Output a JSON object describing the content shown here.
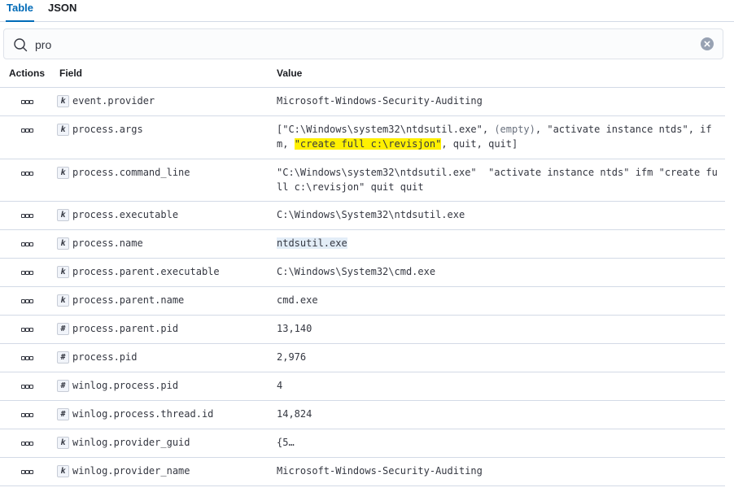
{
  "tabs": [
    "Table",
    "JSON"
  ],
  "search": {
    "value": "pro",
    "placeholder": ""
  },
  "columns": {
    "actions": "Actions",
    "field": "Field",
    "value": "Value"
  },
  "rows": [
    {
      "type": "k",
      "field": "event.provider",
      "value": "Microsoft-Windows-Security-Auditing"
    },
    {
      "type": "k",
      "field": "process.args",
      "value_parts": [
        "[\"C:\\Windows\\system32\\ntdsutil.exe\", ",
        "(empty)",
        ", \"activate instance ntds\", ifm, ",
        "\"create full c:\\revisjon\"",
        ", quit, quit]"
      ]
    },
    {
      "type": "k",
      "field": "process.command_line",
      "value": "\"C:\\Windows\\system32\\ntdsutil.exe\"  \"activate instance ntds\" ifm \"create full c:\\revisjon\" quit quit"
    },
    {
      "type": "k",
      "field": "process.executable",
      "value": "C:\\Windows\\System32\\ntdsutil.exe"
    },
    {
      "type": "k",
      "field": "process.name",
      "value": "ntdsutil.exe"
    },
    {
      "type": "k",
      "field": "process.parent.executable",
      "value": "C:\\Windows\\System32\\cmd.exe"
    },
    {
      "type": "k",
      "field": "process.parent.name",
      "value": "cmd.exe"
    },
    {
      "type": "#",
      "field": "process.parent.pid",
      "value": "13,140"
    },
    {
      "type": "#",
      "field": "process.pid",
      "value": "2,976"
    },
    {
      "type": "#",
      "field": "winlog.process.pid",
      "value": "4"
    },
    {
      "type": "#",
      "field": "winlog.process.thread.id",
      "value": "14,824"
    },
    {
      "type": "k",
      "field": "winlog.provider_guid",
      "value": "{5…"
    },
    {
      "type": "k",
      "field": "winlog.provider_name",
      "value": "Microsoft-Windows-Security-Auditing"
    }
  ]
}
